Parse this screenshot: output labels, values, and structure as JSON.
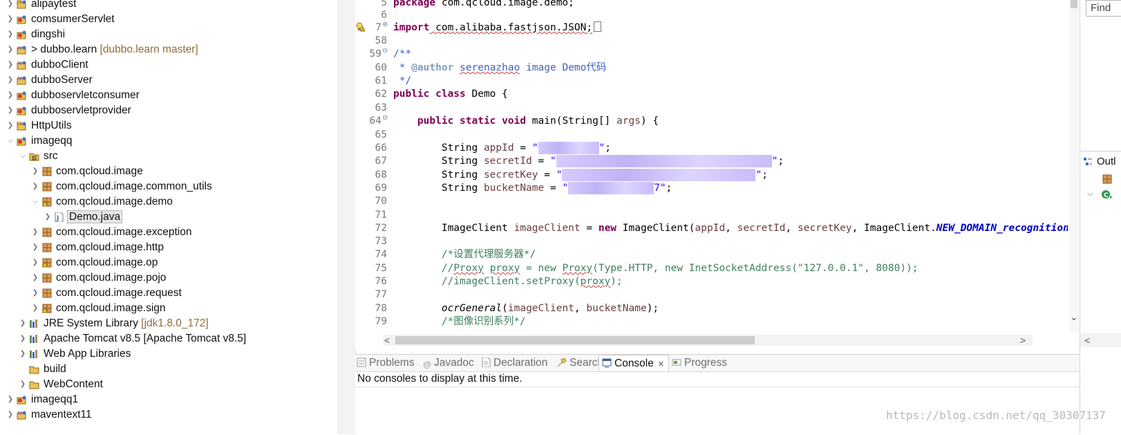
{
  "explorer": {
    "items": [
      {
        "label": "alipaytest",
        "deco": ""
      },
      {
        "label": "comsumerServlet",
        "deco": ""
      },
      {
        "label": "dingshi",
        "deco": ""
      },
      {
        "label": "> dubbo.learn",
        "deco": "[dubbo.learn master]"
      },
      {
        "label": "dubboClient",
        "deco": ""
      },
      {
        "label": "dubboServer",
        "deco": ""
      },
      {
        "label": "dubboservletconsumer",
        "deco": ""
      },
      {
        "label": "dubboservletprovider",
        "deco": ""
      },
      {
        "label": "HttpUtils",
        "deco": ""
      },
      {
        "label": "imageqq",
        "deco": ""
      },
      {
        "label": "src",
        "deco": ""
      },
      {
        "label": "com.qcloud.image",
        "deco": ""
      },
      {
        "label": "com.qcloud.image.common_utils",
        "deco": ""
      },
      {
        "label": "com.qcloud.image.demo",
        "deco": ""
      },
      {
        "label": "Demo.java",
        "deco": ""
      },
      {
        "label": "com.qcloud.image.exception",
        "deco": ""
      },
      {
        "label": "com.qcloud.image.http",
        "deco": ""
      },
      {
        "label": "com.qcloud.image.op",
        "deco": ""
      },
      {
        "label": "com.qcloud.image.pojo",
        "deco": ""
      },
      {
        "label": "com.qcloud.image.request",
        "deco": ""
      },
      {
        "label": "com.qcloud.image.sign",
        "deco": ""
      },
      {
        "label": "JRE System Library",
        "deco": "[jdk1.8.0_172]"
      },
      {
        "label": "Apache Tomcat v8.5 [Apache Tomcat v8.5]",
        "deco": ""
      },
      {
        "label": "Web App Libraries",
        "deco": ""
      },
      {
        "label": "build",
        "deco": ""
      },
      {
        "label": "WebContent",
        "deco": ""
      },
      {
        "label": "imageqq1",
        "deco": ""
      },
      {
        "label": "maventext11",
        "deco": ""
      }
    ]
  },
  "editor": {
    "line_numbers": [
      "5",
      "6",
      "7",
      "58",
      "59",
      "60",
      "61",
      "62",
      "63",
      "64",
      "65",
      "66",
      "67",
      "68",
      "69",
      "70",
      "71",
      "72",
      "73",
      "74",
      "75",
      "76",
      "77",
      "78",
      "79"
    ],
    "code": {
      "l5a": "package",
      "l5b": " com.qcloud.image.demo;",
      "l7a": "import",
      "l7b": " com.alibaba.fastjson.JSON;",
      "l59": "/**",
      "l60a": " * ",
      "l60b": "@author",
      "l60c": " ",
      "l60d": "serenazhao",
      "l60e": " image Demo代码",
      "l61": " */",
      "l62a": "public class",
      "l62b": " Demo {",
      "l64a": "    ",
      "l64b": "public static void",
      "l64c": " main(String[] ",
      "l64d": "args",
      "l64e": ") {",
      "l66a": "        String ",
      "l66b": "appId",
      "l66c": " = ",
      "l66d": "\"",
      "l66e": "\"",
      "l66f": ";",
      "l67a": "        String ",
      "l67b": "secretId",
      "l67c": " = ",
      "l67d": "\"",
      "l67e": "\"",
      "l67f": ";",
      "l68a": "        String ",
      "l68b": "secretKey",
      "l68c": " = ",
      "l68d": "\"",
      "l68e": "\"",
      "l68f": ";",
      "l69a": "        String ",
      "l69b": "bucketName",
      "l69c": " = ",
      "l69d": "\"",
      "l69e": "7\"",
      "l69f": ";",
      "l72a": "        ImageClient ",
      "l72b": "imageClient",
      "l72c": " = ",
      "l72d": "new",
      "l72e": " ImageClient(",
      "l72f": "appId",
      ", ": ", ",
      "l72g": "secretId",
      "l72h": ", ",
      "l72i": "secretKey",
      "l72j": ", ImageClient.",
      "l72k": "NEW_DOMAIN_recognition",
      "l74": "        /*设置代理服务器*/",
      "l75a": "        //",
      "l75b": "Proxy",
      "l75c": " ",
      "l75d": "proxy",
      "l75e": " = new ",
      "l75f": "Proxy",
      "l75g": "(Type.HTTP, new InetSocketAddress(\"127.0.0.1\", 8080));",
      "l76a": "        //imageClient.setProxy(",
      "l76b": "proxy",
      "l76c": ");",
      "l78a": "        ",
      "l78b": "ocrGeneral",
      "l78c": "(",
      "l78d": "imageClient",
      "l78e": "bucketName",
      "l78f": ");",
      "l79": "        /*图像识别系列*/"
    }
  },
  "bottom": {
    "tabs": [
      "Problems",
      "Javadoc",
      "Declaration",
      "Search",
      "Console",
      "Progress"
    ],
    "close_symbol": "✕",
    "console_message": "No consoles to display at this time."
  },
  "right_pane": {
    "find_label": "Find",
    "outline_label": "Outl"
  },
  "watermark": "https://blog.csdn.net/qq_30307137"
}
